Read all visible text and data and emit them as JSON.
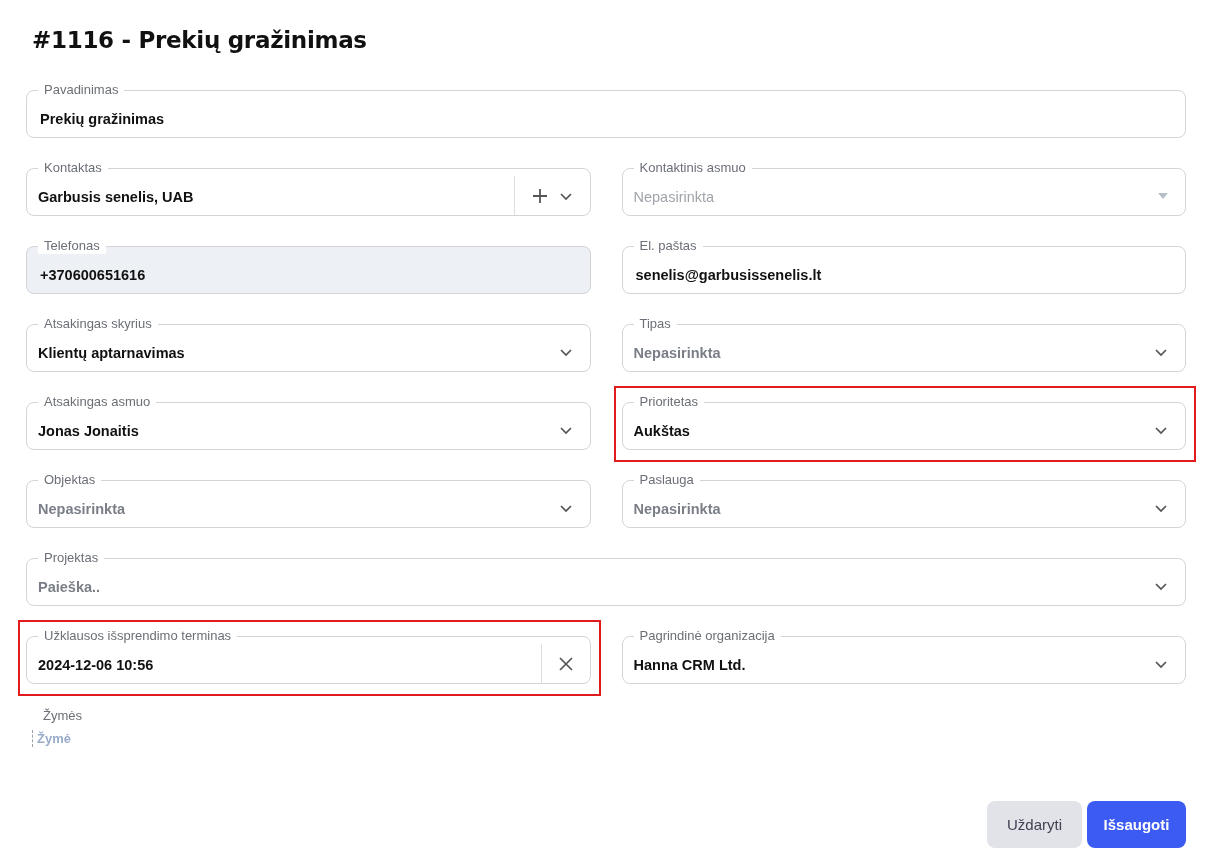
{
  "title": "#1116 - Prekių gražinimas",
  "rows": [
    [
      {
        "label": "Pavadinimas",
        "value": "Prekių gražinimas",
        "kind": "text",
        "highlighted": false
      }
    ],
    [
      {
        "label": "Kontaktas",
        "value": "Garbusis senelis, UAB",
        "kind": "combo",
        "highlighted": false
      },
      {
        "label": "Kontaktinis asmuo",
        "placeholder": "Nepasirinkta",
        "kind": "disabled-select",
        "highlighted": false
      }
    ],
    [
      {
        "label": "Telefonas",
        "value": "+370600651616",
        "kind": "readonly",
        "highlighted": false
      },
      {
        "label": "El. paštas",
        "value": "senelis@garbusissenelis.lt",
        "kind": "text",
        "highlighted": false
      }
    ],
    [
      {
        "label": "Atsakingas skyrius",
        "value": "Klientų aptarnavimas",
        "kind": "select",
        "highlighted": false
      },
      {
        "label": "Tipas",
        "placeholder": "Nepasirinkta",
        "kind": "select",
        "highlighted": false
      }
    ],
    [
      {
        "label": "Atsakingas asmuo",
        "value": "Jonas Jonaitis",
        "kind": "select",
        "highlighted": false
      },
      {
        "label": "Prioritetas",
        "value": "Aukštas",
        "kind": "select",
        "highlighted": true
      }
    ],
    [
      {
        "label": "Objektas",
        "placeholder": "Nepasirinkta",
        "kind": "select",
        "highlighted": false
      },
      {
        "label": "Paslauga",
        "placeholder": "Nepasirinkta",
        "kind": "select",
        "highlighted": false
      }
    ],
    [
      {
        "label": "Projektas",
        "placeholder": "Paieška..",
        "kind": "select",
        "highlighted": false
      }
    ],
    [
      {
        "label": "Užklausos išsprendimo terminas",
        "value": "2024-12-06 10:56",
        "kind": "date",
        "highlighted": true
      },
      {
        "label": "Pagrindinė organizacija",
        "value": "Hanna CRM Ltd.",
        "kind": "select",
        "highlighted": false
      }
    ]
  ],
  "tags": {
    "label": "Žymės",
    "placeholder": "Žymė"
  },
  "buttons": [
    {
      "label": "Uždaryti",
      "kind": "secondary"
    },
    {
      "label": "Išsaugoti",
      "kind": "primary"
    }
  ]
}
